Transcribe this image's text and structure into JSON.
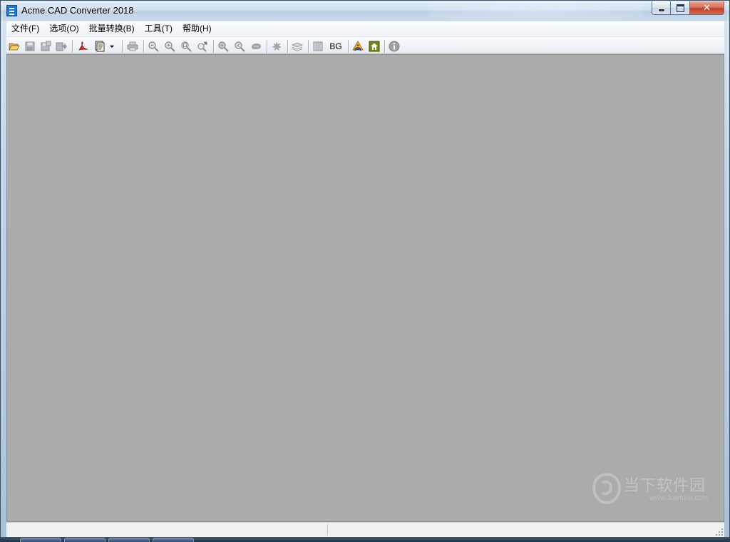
{
  "window": {
    "title": "Acme CAD Converter 2018",
    "controls": {
      "minimize": "minimize",
      "maximize": "maximize",
      "close": "✕"
    }
  },
  "menu": {
    "items": [
      {
        "label": "文件(F)"
      },
      {
        "label": "选项(O)"
      },
      {
        "label": "批量转换(B)"
      },
      {
        "label": "工具(T)"
      },
      {
        "label": "帮助(H)"
      }
    ]
  },
  "toolbar": {
    "buttons": [
      {
        "icon": "open-folder-icon",
        "enabled": true
      },
      {
        "icon": "save-icon",
        "enabled": false
      },
      {
        "icon": "save-as-icon",
        "enabled": false
      },
      {
        "icon": "export-icon",
        "enabled": false
      },
      {
        "icon": "convert-to-pdf-icon",
        "enabled": true
      },
      {
        "icon": "batch-export-icon",
        "enabled": true
      },
      {
        "icon": "dropdown-arrow-icon",
        "enabled": true
      },
      {
        "icon": "print-icon",
        "enabled": false
      },
      {
        "icon": "zoom-out-icon",
        "enabled": false
      },
      {
        "icon": "zoom-in-icon",
        "enabled": false
      },
      {
        "icon": "zoom-window-icon",
        "enabled": false
      },
      {
        "icon": "zoom-extents-icon",
        "enabled": false
      },
      {
        "icon": "zoom-realtime-icon",
        "enabled": false
      },
      {
        "icon": "zoom-previous-icon",
        "enabled": false
      },
      {
        "icon": "pan-icon",
        "enabled": false
      },
      {
        "icon": "regen-icon",
        "enabled": false
      },
      {
        "icon": "layers-icon",
        "enabled": false
      },
      {
        "icon": "layout-icon",
        "enabled": false
      },
      {
        "icon": "bg-toggle-icon",
        "enabled": true,
        "label": "BG"
      },
      {
        "icon": "help-book-icon",
        "enabled": true
      },
      {
        "icon": "home-icon",
        "enabled": true
      },
      {
        "icon": "info-icon",
        "enabled": false
      }
    ]
  },
  "watermark": {
    "text": "当下软件园",
    "subtext": "www.downxia.com"
  },
  "statusbar": {
    "left": "",
    "right": ""
  },
  "colors": {
    "canvas": "#ababab",
    "title_gradient_top": "#e4eef8",
    "close_button": "#c2402a"
  }
}
